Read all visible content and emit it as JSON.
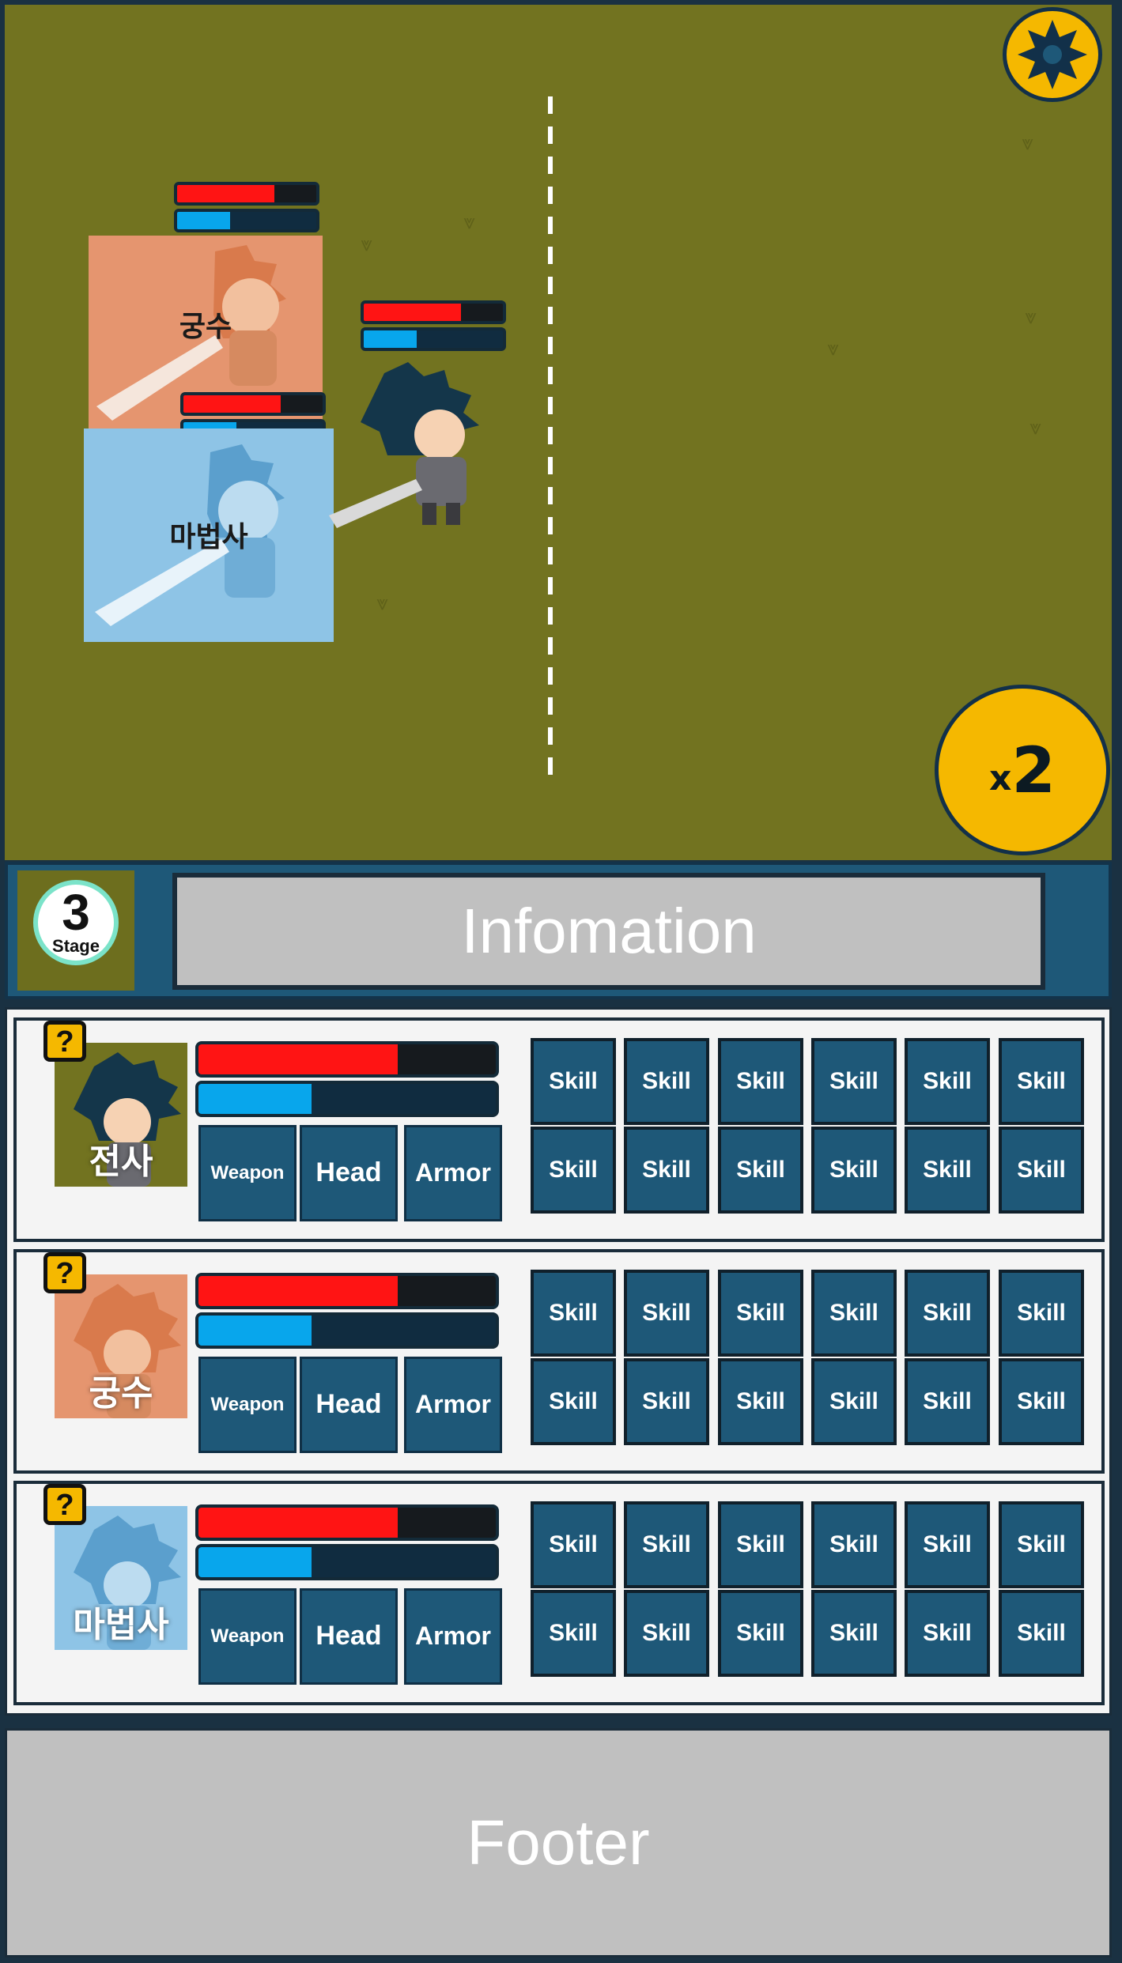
{
  "colors": {
    "field": "#727320",
    "panel": "#1e5878",
    "hp": "#ff1414",
    "mp": "#08a6ec",
    "accent": "#f5b800",
    "gray": "#c0c0c0"
  },
  "battle": {
    "settings_icon": "gear-icon",
    "speed_prefix": "x",
    "speed_value": "2",
    "units": [
      {
        "name": "궁수",
        "tint": "#e5956f",
        "hp": 0.7,
        "mp": 0.38
      },
      {
        "name": "마법사",
        "tint": "#8ec4e6",
        "hp": 0.7,
        "mp": 0.38
      },
      {
        "name": "",
        "tint": "",
        "hp": 0.7,
        "mp": 0.38
      }
    ]
  },
  "info": {
    "stage_number": "3",
    "stage_label": "Stage",
    "panel_text": "Infomation"
  },
  "party": [
    {
      "name": "전사",
      "portrait_bg": "#727320",
      "hp": 0.67,
      "mp": 0.38,
      "equipment": [
        "Weapon",
        "Head",
        "Armor"
      ],
      "skills": [
        "Skill",
        "Skill",
        "Skill",
        "Skill",
        "Skill",
        "Skill",
        "Skill",
        "Skill",
        "Skill",
        "Skill",
        "Skill",
        "Skill"
      ]
    },
    {
      "name": "궁수",
      "portrait_bg": "#e5956f",
      "hp": 0.67,
      "mp": 0.38,
      "equipment": [
        "Weapon",
        "Head",
        "Armor"
      ],
      "skills": [
        "Skill",
        "Skill",
        "Skill",
        "Skill",
        "Skill",
        "Skill",
        "Skill",
        "Skill",
        "Skill",
        "Skill",
        "Skill",
        "Skill"
      ]
    },
    {
      "name": "마법사",
      "portrait_bg": "#8ec4e6",
      "hp": 0.67,
      "mp": 0.38,
      "equipment": [
        "Weapon",
        "Head",
        "Armor"
      ],
      "skills": [
        "Skill",
        "Skill",
        "Skill",
        "Skill",
        "Skill",
        "Skill",
        "Skill",
        "Skill",
        "Skill",
        "Skill",
        "Skill",
        "Skill"
      ]
    }
  ],
  "footer": {
    "text": "Footer"
  }
}
